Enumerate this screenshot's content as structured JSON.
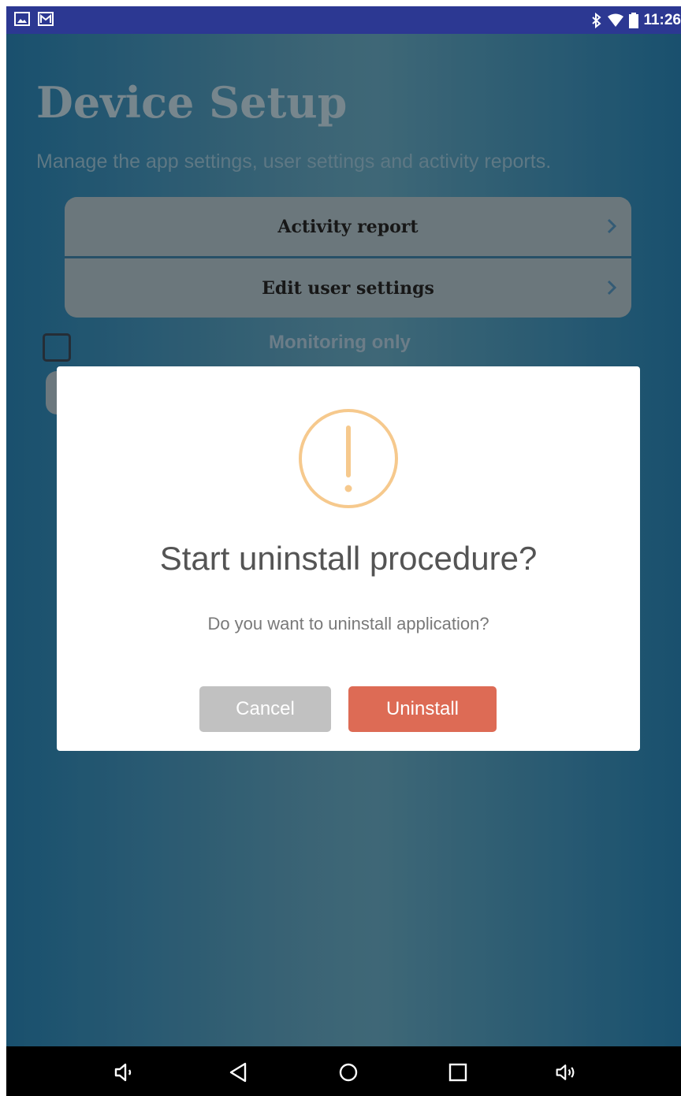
{
  "status_bar": {
    "time": "11:26",
    "left_icons": [
      "image-icon",
      "gmail-icon"
    ],
    "right_icons": [
      "bluetooth-icon",
      "wifi-icon",
      "battery-icon"
    ],
    "background": "#2c3892"
  },
  "page": {
    "title": "Device Setup",
    "subtitle": "Manage the app settings, user settings and activity reports.",
    "menu": [
      {
        "label": "Activity report"
      },
      {
        "label": "Edit user settings"
      }
    ],
    "checkbox_label": "Monitoring only"
  },
  "dialog": {
    "icon": "warning-icon",
    "title": "Start uninstall procedure?",
    "text": "Do you want to uninstall application?",
    "cancel_label": "Cancel",
    "confirm_label": "Uninstall",
    "colors": {
      "warning": "#f6c98d",
      "cancel": "#c1c1c1",
      "confirm": "#dd6b55"
    }
  },
  "nav_bar": {
    "icons": [
      "volume-down-icon",
      "back-icon",
      "home-icon",
      "recents-icon",
      "volume-up-icon"
    ]
  }
}
